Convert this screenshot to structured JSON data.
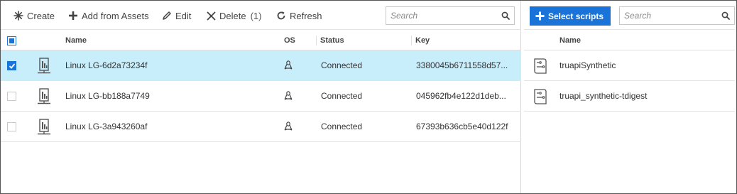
{
  "toolbar": {
    "create": "Create",
    "add_from_assets": "Add from Assets",
    "edit": "Edit",
    "delete": "Delete",
    "delete_count": "(1)",
    "refresh": "Refresh",
    "search_placeholder": "Search"
  },
  "grid": {
    "columns": {
      "name": "Name",
      "os": "OS",
      "status": "Status",
      "key": "Key"
    },
    "rows": [
      {
        "name": "Linux LG-6d2a73234f",
        "os": "linux-icon",
        "status": "Connected",
        "key": "3380045b6711558d57...",
        "selected": true
      },
      {
        "name": "Linux LG-bb188a7749",
        "os": "linux-icon",
        "status": "Connected",
        "key": "045962fb4e122d1deb...",
        "selected": false
      },
      {
        "name": "Linux LG-3a943260af",
        "os": "linux-icon",
        "status": "Connected",
        "key": "67393b636cb5e40d122f",
        "selected": false
      }
    ]
  },
  "scripts_panel": {
    "select_button": "Select scripts",
    "search_placeholder": "Search",
    "column_name": "Name",
    "rows": [
      {
        "name": "truapiSynthetic",
        "icon": "script-icon"
      },
      {
        "name": "truapi_synthetic-tdigest",
        "icon": "script-icon"
      }
    ]
  },
  "colors": {
    "accent": "#1a73d9",
    "selected_row": "#c9eefb"
  }
}
